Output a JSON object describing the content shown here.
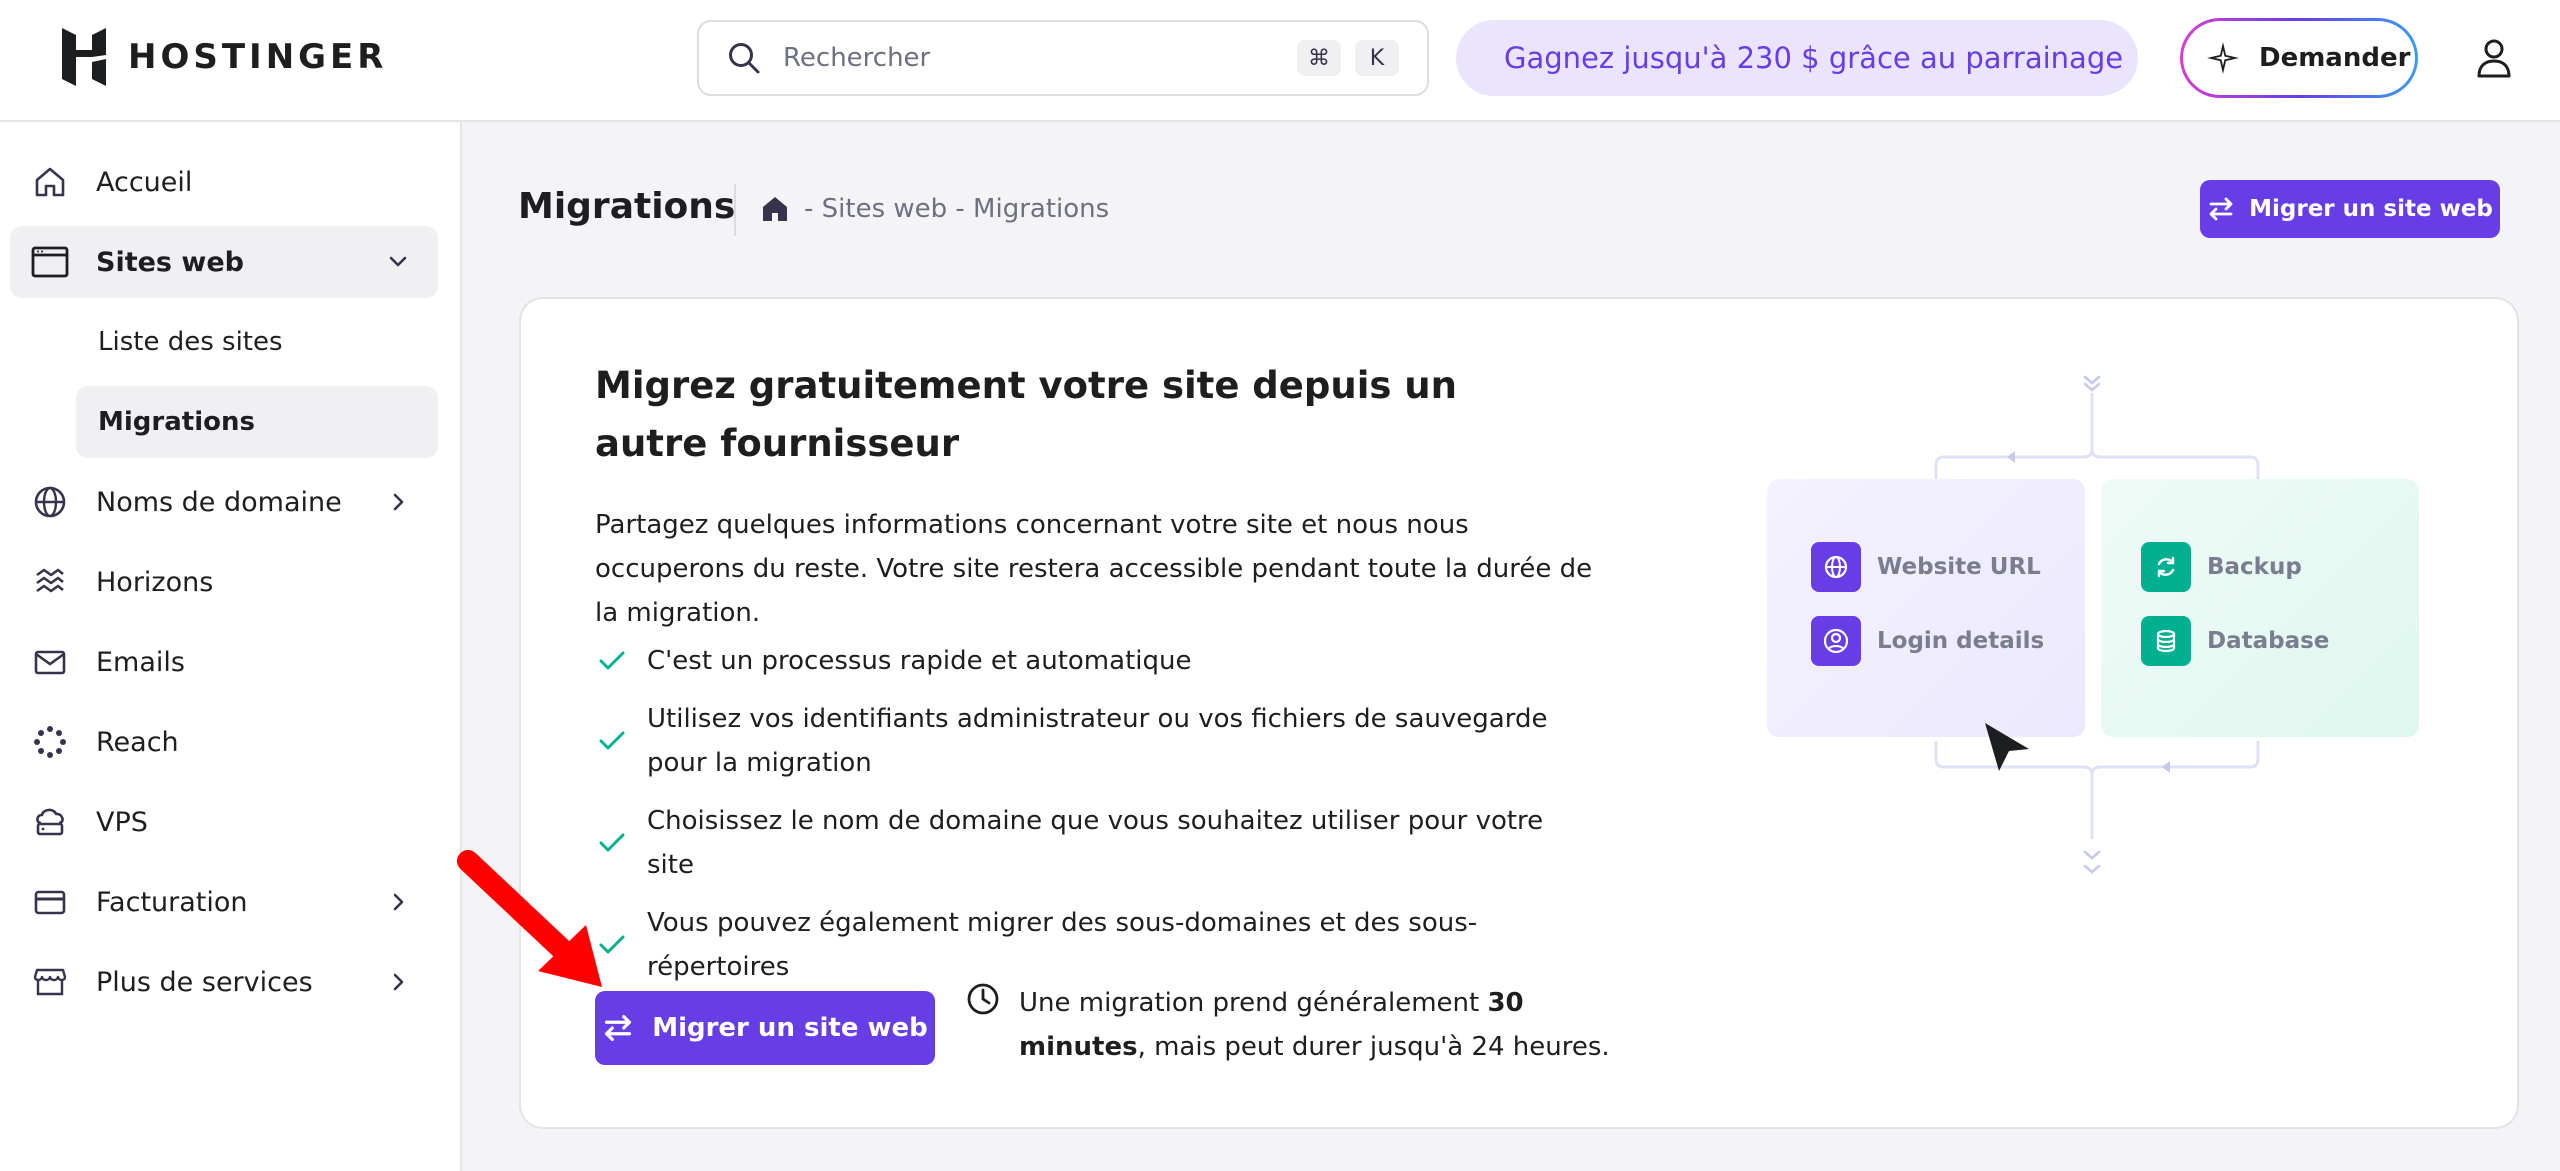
{
  "header": {
    "brand": "HOSTINGER",
    "search_placeholder": "Rechercher",
    "shortcut_keys": [
      "⌘",
      "K"
    ],
    "referral_text": "Gagnez jusqu'à 230 $ grâce au parrainage",
    "ask_label": "Demander"
  },
  "sidebar": {
    "items": [
      {
        "label": "Accueil"
      },
      {
        "label": "Sites web"
      },
      {
        "label": "Noms de domaine"
      },
      {
        "label": "Horizons"
      },
      {
        "label": "Emails"
      },
      {
        "label": "Reach"
      },
      {
        "label": "VPS"
      },
      {
        "label": "Facturation"
      },
      {
        "label": "Plus de services"
      }
    ],
    "sub_items": [
      {
        "label": "Liste des sites"
      },
      {
        "label": "Migrations"
      }
    ]
  },
  "page": {
    "title": "Migrations",
    "breadcrumb": "- Sites web - Migrations",
    "top_button": "Migrer un site web"
  },
  "card": {
    "title": "Migrez gratuitement votre site depuis un autre fournisseur",
    "description": "Partagez quelques informations concernant votre site et nous nous occuperons du reste. Votre site restera accessible pendant toute la durée de la migration.",
    "checks": [
      "C'est un processus rapide et automatique",
      "Utilisez vos identifiants administrateur ou vos fichiers de sauvegarde pour la migration",
      "Choisissez le nom de domaine que vous souhaitez utiliser pour votre site",
      "Vous pouvez également migrer des sous-domaines et des sous-répertoires"
    ],
    "button": "Migrer un site web",
    "note_before": "Une migration prend généralement ",
    "note_bold": "30 minutes",
    "note_after": ", mais peut durer jusqu'à 24 heures."
  },
  "illustration": {
    "left": [
      "Website URL",
      "Login details"
    ],
    "right": [
      "Backup",
      "Database"
    ]
  },
  "colors": {
    "accent": "#673de6",
    "referral_bg": "#ebe4ff",
    "check": "#00b090",
    "annotation_arrow": "#ff0000"
  }
}
